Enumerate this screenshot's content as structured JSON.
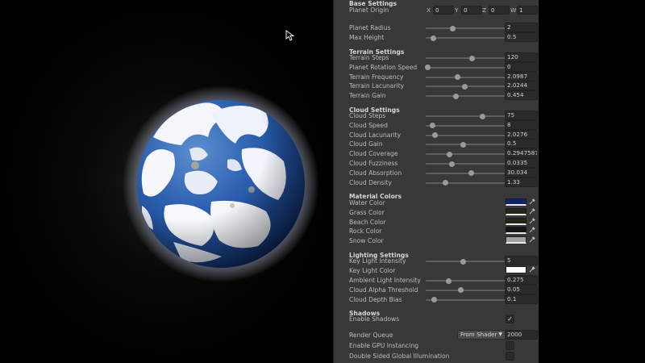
{
  "base": {
    "header": "Base Settings",
    "origin_label": "Planet Origin",
    "origin": [
      {
        "axis": "X",
        "value": "0"
      },
      {
        "axis": "Y",
        "value": "0"
      },
      {
        "axis": "Z",
        "value": "0"
      },
      {
        "axis": "W",
        "value": "1"
      }
    ],
    "radius": {
      "label": "Planet Radius",
      "value": "2",
      "fraction": 0.31
    },
    "max_height": {
      "label": "Max  Height",
      "value": "0.5",
      "fraction": 0.09
    }
  },
  "terrain": {
    "header": "Terrain Settings",
    "rows": [
      {
        "label": "Terrain Steps",
        "value": "120",
        "fraction": 0.53
      },
      {
        "label": "Planet Rotation Speed",
        "value": "0",
        "fraction": 0.02
      },
      {
        "label": "Terrain Frequency",
        "value": "2.0987",
        "fraction": 0.37
      },
      {
        "label": "Terrain Lacunarity",
        "value": "2.0244",
        "fraction": 0.45
      },
      {
        "label": "Terrain Gain",
        "value": "0.454",
        "fraction": 0.35
      }
    ]
  },
  "cloud": {
    "header": "Cloud Settings",
    "rows": [
      {
        "label": "Cloud Steps",
        "value": "75",
        "fraction": 0.65
      },
      {
        "label": "Cloud Speed",
        "value": "8",
        "fraction": 0.08
      },
      {
        "label": "Cloud Lacunarity",
        "value": "2.0276",
        "fraction": 0.11
      },
      {
        "label": "Cloud Gain",
        "value": "0.5",
        "fraction": 0.43
      },
      {
        "label": "Cloud Coverage",
        "value": "0.2947587",
        "fraction": 0.27
      },
      {
        "label": "Cloud Fuzziness",
        "value": "0.0335",
        "fraction": 0.3
      },
      {
        "label": "Cloud Absorption",
        "value": "30.034",
        "fraction": 0.52
      },
      {
        "label": "Cloud Density",
        "value": "1.33",
        "fraction": 0.23
      }
    ]
  },
  "materials": {
    "header": "Material Colors",
    "rows": [
      {
        "label": "Water Color",
        "color": "#10216e",
        "icon": "eyedropper-icon"
      },
      {
        "label": "Grass Color",
        "color": "#1f2a12",
        "icon": "eyedropper-icon"
      },
      {
        "label": "Beach Color",
        "color": "#262414",
        "icon": "eyedropper-icon"
      },
      {
        "label": "Rock Color",
        "color": "#141414",
        "icon": "eyedropper-icon"
      },
      {
        "label": "Snow Color",
        "color": "#a3a3a3",
        "icon": "eyedropper-icon"
      }
    ]
  },
  "lighting": {
    "header": "Lighting Settings",
    "key_intensity": {
      "label": "Key Light Intensity",
      "value": "5",
      "fraction": 0.43
    },
    "key_color": {
      "label": "Key Light Color",
      "color": "#ffffff",
      "icon": "eyedropper-icon"
    },
    "rows": [
      {
        "label": "Ambient Light Intensity",
        "value": "0.275",
        "fraction": 0.26
      },
      {
        "label": "Cloud Alpha Threshold",
        "value": "0.05",
        "fraction": 0.4
      },
      {
        "label": "Cloud Depth Bias",
        "value": "0.1",
        "fraction": 0.1
      }
    ]
  },
  "shadows": {
    "header": "Shadows",
    "enable_label": "Enable Shadows",
    "enabled": true,
    "check_glyph": "✓"
  },
  "render": {
    "queue_label": "Render Queue",
    "queue_mode": "From Shader",
    "queue_value": "2000",
    "gpu_instancing_label": "Enable GPU Instancing",
    "double_sided_label": "Double Sided Global Illumination"
  },
  "colors": {
    "inspector_bg": "#383838",
    "field_bg": "#2a2a2a",
    "ocean": "#2b63b8",
    "snow": "#f4f6fb"
  }
}
